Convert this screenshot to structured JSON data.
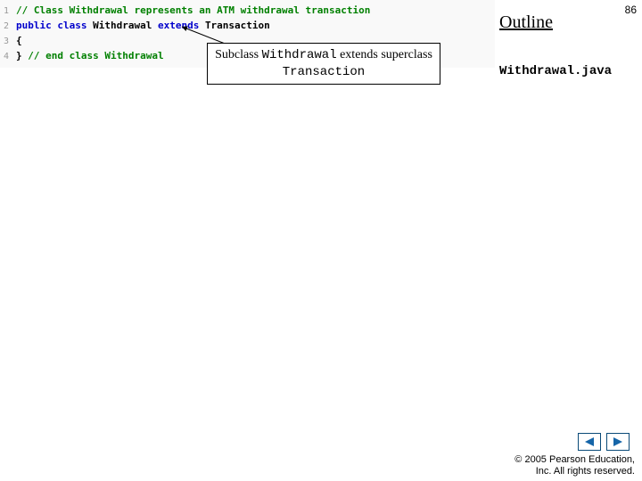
{
  "page_number": "86",
  "outline_heading": "Outline",
  "filename": "Withdrawal.java",
  "code": {
    "lines": [
      {
        "n": "1",
        "segments": [
          {
            "cls": "c-comment",
            "t": "// Class Withdrawal represents an ATM withdrawal transaction"
          }
        ]
      },
      {
        "n": "2",
        "segments": [
          {
            "cls": "c-keyword",
            "t": "public class "
          },
          {
            "cls": "c-plain",
            "t": "Withdrawal "
          },
          {
            "cls": "c-keyword",
            "t": "extends "
          },
          {
            "cls": "c-plain",
            "t": "Transaction"
          }
        ]
      },
      {
        "n": "3",
        "segments": [
          {
            "cls": "c-plain",
            "t": "{"
          }
        ]
      },
      {
        "n": "4",
        "segments": [
          {
            "cls": "c-plain",
            "t": "} "
          },
          {
            "cls": "c-comment",
            "t": "// end class Withdrawal"
          }
        ]
      }
    ]
  },
  "callout": {
    "prefix": "Subclass ",
    "code1": "Withdrawal",
    "mid": " extends superclass ",
    "code2": "Transaction"
  },
  "copyright": {
    "line1": "© 2005 Pearson Education,",
    "line2": "Inc.  All rights reserved."
  }
}
